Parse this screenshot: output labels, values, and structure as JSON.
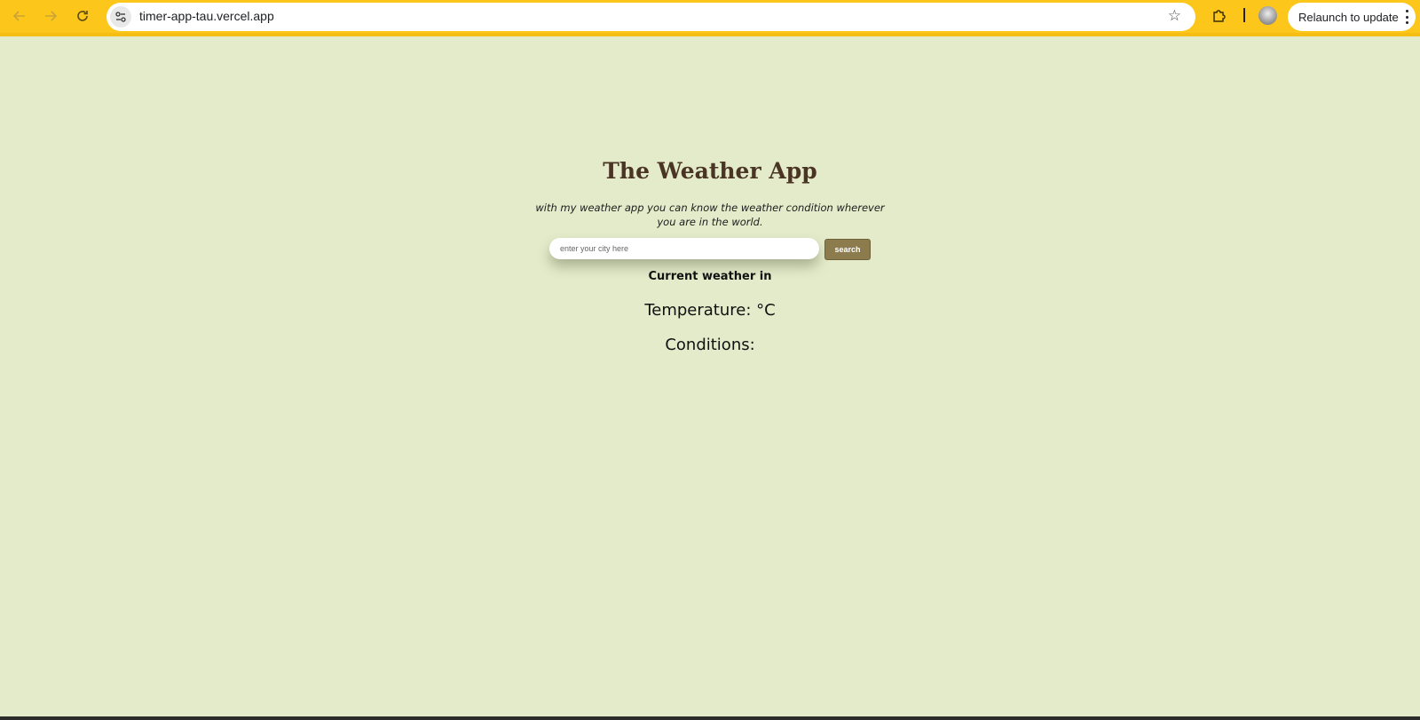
{
  "browser": {
    "url": "timer-app-tau.vercel.app",
    "relaunch_label": "Relaunch to update",
    "icons": {
      "back": "back-arrow-icon",
      "forward": "forward-arrow-icon",
      "reload": "reload-icon",
      "site_info": "tune-icon",
      "bookmark": "star-icon",
      "extensions": "puzzle-icon",
      "menu": "kebab-menu-icon"
    },
    "colors": {
      "toolbar": "#fdc61a"
    }
  },
  "app": {
    "title": "The Weather App",
    "subtitle": "with my weather app you can know the weather condition wherever you are in the world.",
    "search": {
      "placeholder": "enter your city here",
      "value": "",
      "button_label": "search"
    },
    "current_weather_label": "Current weather in",
    "temperature_text": "Temperature: °C",
    "conditions_text": "Conditions:",
    "colors": {
      "background": "#e4ebca",
      "title": "#4a3424",
      "button": "#8b7b4d"
    }
  }
}
